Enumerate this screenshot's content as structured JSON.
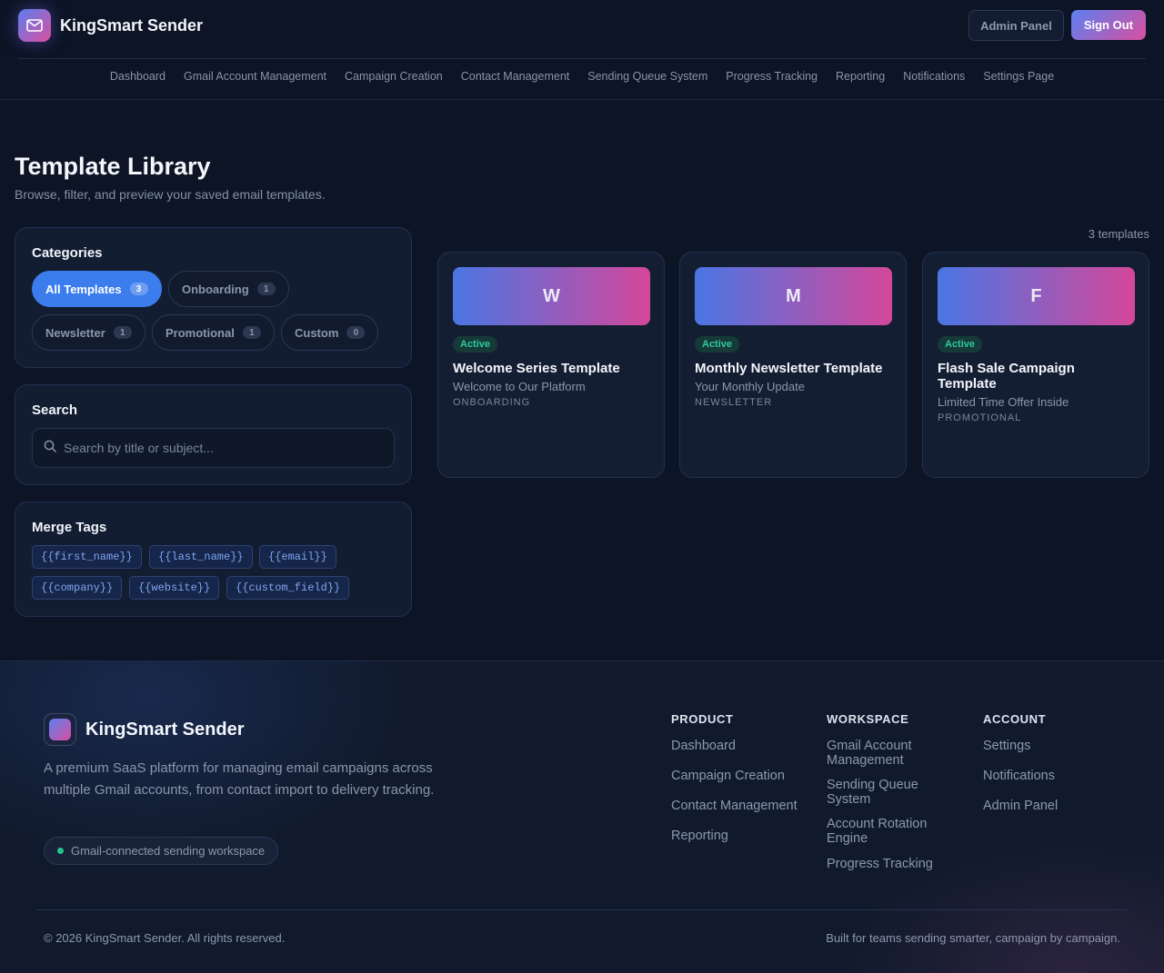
{
  "app": {
    "name": "KingSmart Sender",
    "admin_label": "Admin Panel",
    "signout_label": "Sign Out"
  },
  "nav": [
    "Dashboard",
    "Gmail Account Management",
    "Campaign Creation",
    "Contact Management",
    "Sending Queue System",
    "Progress Tracking",
    "Reporting",
    "Notifications",
    "Settings Page"
  ],
  "page": {
    "title": "Template Library",
    "subtitle": "Browse, filter, and preview your saved email templates."
  },
  "categories": {
    "title": "Categories",
    "items": [
      {
        "label": "All Templates",
        "count": "3",
        "active": true
      },
      {
        "label": "Onboarding",
        "count": "1",
        "active": false
      },
      {
        "label": "Newsletter",
        "count": "1",
        "active": false
      },
      {
        "label": "Promotional",
        "count": "1",
        "active": false
      },
      {
        "label": "Custom",
        "count": "0",
        "active": false
      }
    ]
  },
  "search": {
    "title": "Search",
    "placeholder": "Search by title or subject...",
    "value": ""
  },
  "merge_tags": {
    "title": "Merge Tags",
    "items": [
      "{{first_name}}",
      "{{last_name}}",
      "{{email}}",
      "{{company}}",
      "{{website}}",
      "{{custom_field}}"
    ]
  },
  "templates": {
    "count_label": "3 templates",
    "items": [
      {
        "initial": "W",
        "status": "Active",
        "title": "Welcome Series Template",
        "subject": "Welcome to Our Platform",
        "category": "ONBOARDING"
      },
      {
        "initial": "M",
        "status": "Active",
        "title": "Monthly Newsletter Template",
        "subject": "Your Monthly Update",
        "category": "NEWSLETTER"
      },
      {
        "initial": "F",
        "status": "Active",
        "title": "Flash Sale Campaign Template",
        "subject": "Limited Time Offer Inside",
        "category": "PROMOTIONAL"
      }
    ]
  },
  "footer": {
    "brand": "KingSmart Sender",
    "description": "A premium SaaS platform for managing email campaigns across multiple Gmail accounts, from contact import to delivery tracking.",
    "pill": "Gmail-connected sending workspace",
    "columns": [
      {
        "title": "PRODUCT",
        "links": [
          "Dashboard",
          "Campaign Creation",
          "Contact Management",
          "Reporting"
        ]
      },
      {
        "title": "WORKSPACE",
        "links": [
          "Gmail Account Management",
          "Sending Queue System",
          "Account Rotation Engine",
          "Progress Tracking"
        ]
      },
      {
        "title": "ACCOUNT",
        "links": [
          "Settings",
          "Notifications",
          "Admin Panel"
        ]
      }
    ],
    "copyright": "© 2026 KingSmart Sender. All rights reserved.",
    "tagline": "Built for teams sending smarter, campaign by campaign."
  },
  "colors": {
    "background": "#0c1425",
    "accent_blue": "#3b7ded",
    "gradient_start": "#5b80f2",
    "gradient_end": "#d94f9e",
    "active_green": "#2ec99a"
  }
}
